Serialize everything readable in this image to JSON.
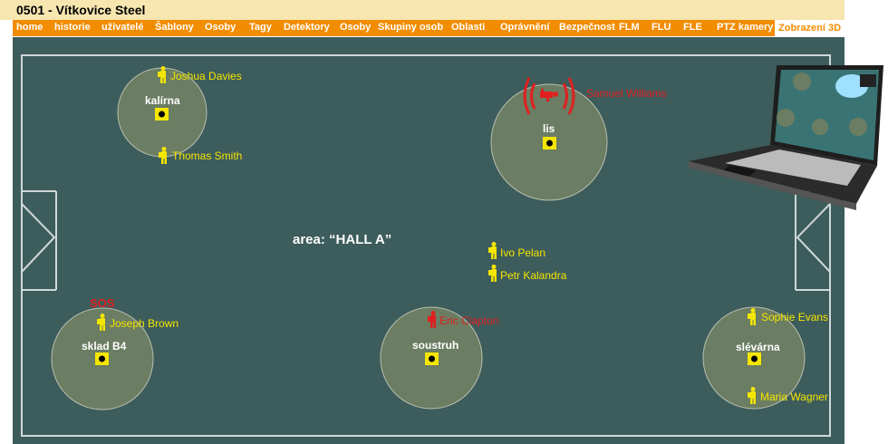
{
  "window": {
    "title": "0501 - Vítkovice Steel"
  },
  "nav": {
    "items": [
      {
        "label": "home"
      },
      {
        "label": "historie"
      },
      {
        "label": "uživatelé"
      },
      {
        "label": "Šablony"
      },
      {
        "label": "Osoby"
      },
      {
        "label": "Tagy"
      },
      {
        "label": "Detektory"
      },
      {
        "label": "Osoby"
      },
      {
        "label": "Skupiny osob"
      },
      {
        "label": "Oblasti"
      },
      {
        "label": "Oprávnění"
      },
      {
        "label": "Bezpečnost"
      },
      {
        "label": "FLM"
      },
      {
        "label": "FLU"
      },
      {
        "label": "FLE"
      },
      {
        "label": "PTZ kamery"
      },
      {
        "label": "Zobrazení 3D"
      }
    ],
    "active_index": 16
  },
  "map": {
    "area_label": "area: “HALL  A”",
    "zones": [
      {
        "name": "kalírna"
      },
      {
        "name": "lis"
      },
      {
        "name": "sklad B4"
      },
      {
        "name": "soustruh"
      },
      {
        "name": "slévárna"
      }
    ],
    "persons": [
      {
        "name": "Joshua  Davies",
        "status": "normal"
      },
      {
        "name": "Thomas Smith",
        "status": "normal"
      },
      {
        "name": "Samuel Williams",
        "status": "alarm"
      },
      {
        "name": "Ivo Pelan",
        "status": "normal"
      },
      {
        "name": "Petr Kalandra",
        "status": "normal"
      },
      {
        "name": "Joseph Brown",
        "status": "normal"
      },
      {
        "name": "Eric Clapton",
        "status": "alarm"
      },
      {
        "name": "Sophie Evans",
        "status": "normal"
      },
      {
        "name": "Maria Wagner",
        "status": "normal"
      }
    ],
    "sos_label": "SOS"
  },
  "colors": {
    "field": "#3d5c5c",
    "zone": "#6b7d62",
    "nav": "#f28c00",
    "title_bg": "#f7e6b0",
    "person_normal": "#f5e600",
    "person_alarm": "#e02020"
  },
  "icons": {
    "person": "person-icon",
    "detector": "detector-icon",
    "alarm": "alarm-waves-icon",
    "laptop": "laptop-icon"
  }
}
